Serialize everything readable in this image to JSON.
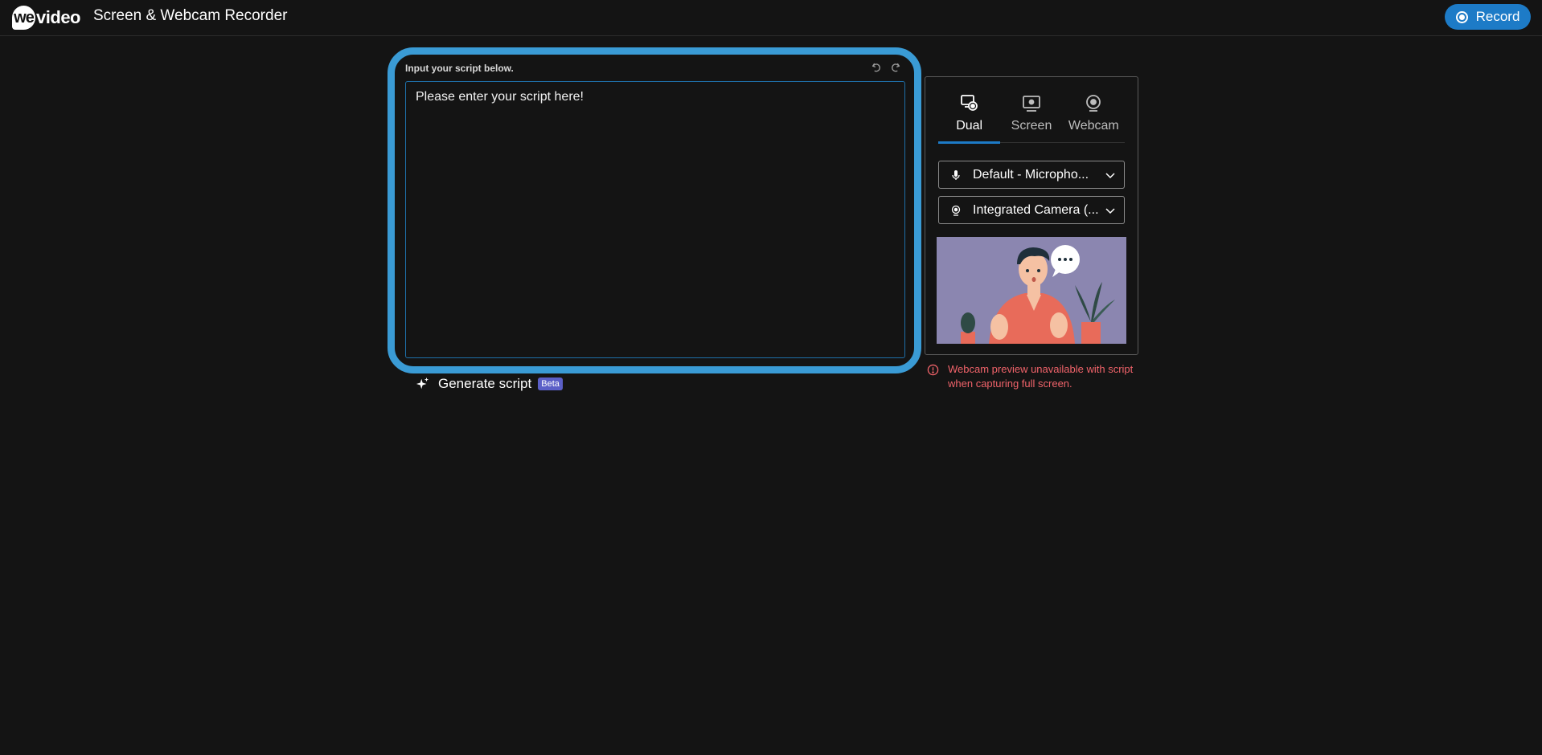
{
  "header": {
    "logo_we": "we",
    "logo_video": "video",
    "title": "Screen & Webcam Recorder",
    "record_label": "Record",
    "accent": "#1d7bc7"
  },
  "script": {
    "label": "Input your script below.",
    "placeholder": "Please enter your script here!",
    "value": "",
    "undo_icon": "undo-icon",
    "redo_icon": "redo-icon",
    "highlight_color": "#3a9bd5"
  },
  "generate": {
    "label": "Generate script",
    "badge": "Beta",
    "icon": "sparkle-icon"
  },
  "recorder": {
    "modes": [
      {
        "label": "Dual",
        "icon": "dual-icon",
        "active": true
      },
      {
        "label": "Screen",
        "icon": "screen-icon",
        "active": false
      },
      {
        "label": "Webcam",
        "icon": "webcam-icon",
        "active": false
      }
    ],
    "microphone": "Default - Micropho...",
    "camera": "Integrated Camera (...",
    "warning": "Webcam preview unavailable with script when capturing full screen.",
    "warning_color": "#f0636a"
  }
}
